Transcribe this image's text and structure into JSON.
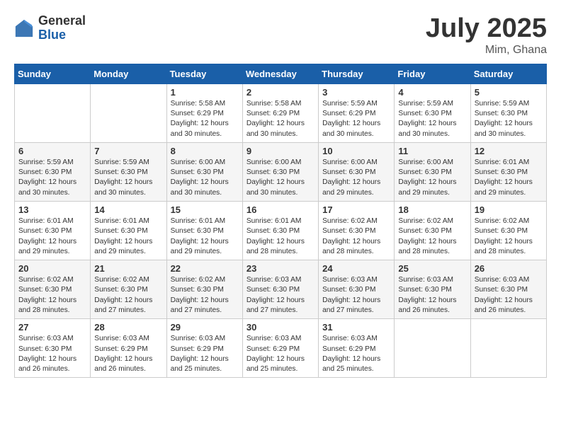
{
  "logo": {
    "general": "General",
    "blue": "Blue"
  },
  "header": {
    "month": "July 2025",
    "location": "Mim, Ghana"
  },
  "weekdays": [
    "Sunday",
    "Monday",
    "Tuesday",
    "Wednesday",
    "Thursday",
    "Friday",
    "Saturday"
  ],
  "weeks": [
    [
      {
        "day": "",
        "info": ""
      },
      {
        "day": "",
        "info": ""
      },
      {
        "day": "1",
        "info": "Sunrise: 5:58 AM\nSunset: 6:29 PM\nDaylight: 12 hours and 30 minutes."
      },
      {
        "day": "2",
        "info": "Sunrise: 5:58 AM\nSunset: 6:29 PM\nDaylight: 12 hours and 30 minutes."
      },
      {
        "day": "3",
        "info": "Sunrise: 5:59 AM\nSunset: 6:29 PM\nDaylight: 12 hours and 30 minutes."
      },
      {
        "day": "4",
        "info": "Sunrise: 5:59 AM\nSunset: 6:30 PM\nDaylight: 12 hours and 30 minutes."
      },
      {
        "day": "5",
        "info": "Sunrise: 5:59 AM\nSunset: 6:30 PM\nDaylight: 12 hours and 30 minutes."
      }
    ],
    [
      {
        "day": "6",
        "info": "Sunrise: 5:59 AM\nSunset: 6:30 PM\nDaylight: 12 hours and 30 minutes."
      },
      {
        "day": "7",
        "info": "Sunrise: 5:59 AM\nSunset: 6:30 PM\nDaylight: 12 hours and 30 minutes."
      },
      {
        "day": "8",
        "info": "Sunrise: 6:00 AM\nSunset: 6:30 PM\nDaylight: 12 hours and 30 minutes."
      },
      {
        "day": "9",
        "info": "Sunrise: 6:00 AM\nSunset: 6:30 PM\nDaylight: 12 hours and 30 minutes."
      },
      {
        "day": "10",
        "info": "Sunrise: 6:00 AM\nSunset: 6:30 PM\nDaylight: 12 hours and 29 minutes."
      },
      {
        "day": "11",
        "info": "Sunrise: 6:00 AM\nSunset: 6:30 PM\nDaylight: 12 hours and 29 minutes."
      },
      {
        "day": "12",
        "info": "Sunrise: 6:01 AM\nSunset: 6:30 PM\nDaylight: 12 hours and 29 minutes."
      }
    ],
    [
      {
        "day": "13",
        "info": "Sunrise: 6:01 AM\nSunset: 6:30 PM\nDaylight: 12 hours and 29 minutes."
      },
      {
        "day": "14",
        "info": "Sunrise: 6:01 AM\nSunset: 6:30 PM\nDaylight: 12 hours and 29 minutes."
      },
      {
        "day": "15",
        "info": "Sunrise: 6:01 AM\nSunset: 6:30 PM\nDaylight: 12 hours and 29 minutes."
      },
      {
        "day": "16",
        "info": "Sunrise: 6:01 AM\nSunset: 6:30 PM\nDaylight: 12 hours and 28 minutes."
      },
      {
        "day": "17",
        "info": "Sunrise: 6:02 AM\nSunset: 6:30 PM\nDaylight: 12 hours and 28 minutes."
      },
      {
        "day": "18",
        "info": "Sunrise: 6:02 AM\nSunset: 6:30 PM\nDaylight: 12 hours and 28 minutes."
      },
      {
        "day": "19",
        "info": "Sunrise: 6:02 AM\nSunset: 6:30 PM\nDaylight: 12 hours and 28 minutes."
      }
    ],
    [
      {
        "day": "20",
        "info": "Sunrise: 6:02 AM\nSunset: 6:30 PM\nDaylight: 12 hours and 28 minutes."
      },
      {
        "day": "21",
        "info": "Sunrise: 6:02 AM\nSunset: 6:30 PM\nDaylight: 12 hours and 27 minutes."
      },
      {
        "day": "22",
        "info": "Sunrise: 6:02 AM\nSunset: 6:30 PM\nDaylight: 12 hours and 27 minutes."
      },
      {
        "day": "23",
        "info": "Sunrise: 6:03 AM\nSunset: 6:30 PM\nDaylight: 12 hours and 27 minutes."
      },
      {
        "day": "24",
        "info": "Sunrise: 6:03 AM\nSunset: 6:30 PM\nDaylight: 12 hours and 27 minutes."
      },
      {
        "day": "25",
        "info": "Sunrise: 6:03 AM\nSunset: 6:30 PM\nDaylight: 12 hours and 26 minutes."
      },
      {
        "day": "26",
        "info": "Sunrise: 6:03 AM\nSunset: 6:30 PM\nDaylight: 12 hours and 26 minutes."
      }
    ],
    [
      {
        "day": "27",
        "info": "Sunrise: 6:03 AM\nSunset: 6:30 PM\nDaylight: 12 hours and 26 minutes."
      },
      {
        "day": "28",
        "info": "Sunrise: 6:03 AM\nSunset: 6:29 PM\nDaylight: 12 hours and 26 minutes."
      },
      {
        "day": "29",
        "info": "Sunrise: 6:03 AM\nSunset: 6:29 PM\nDaylight: 12 hours and 25 minutes."
      },
      {
        "day": "30",
        "info": "Sunrise: 6:03 AM\nSunset: 6:29 PM\nDaylight: 12 hours and 25 minutes."
      },
      {
        "day": "31",
        "info": "Sunrise: 6:03 AM\nSunset: 6:29 PM\nDaylight: 12 hours and 25 minutes."
      },
      {
        "day": "",
        "info": ""
      },
      {
        "day": "",
        "info": ""
      }
    ]
  ]
}
